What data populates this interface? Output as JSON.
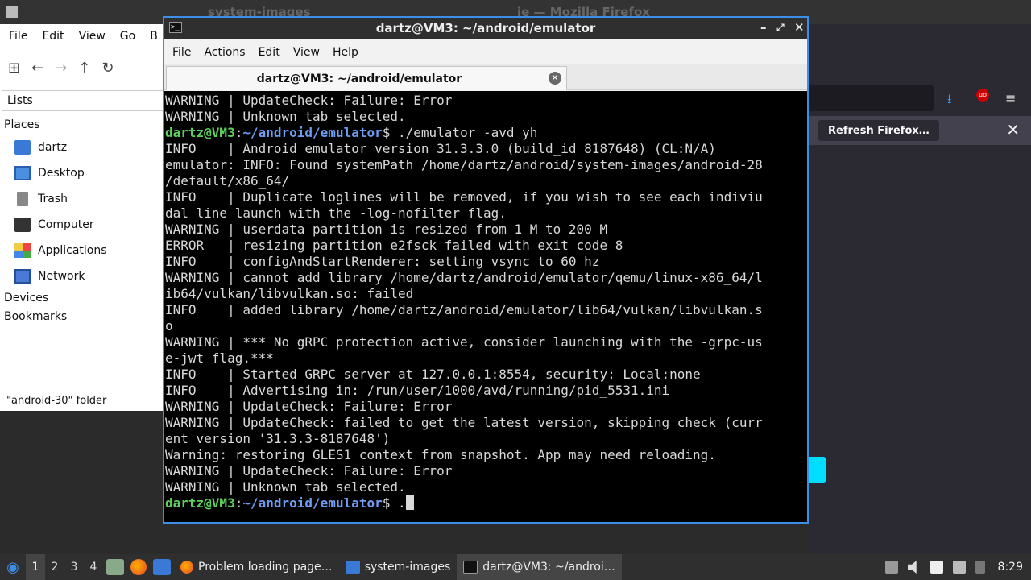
{
  "firefox": {
    "title_left": "system-images",
    "title_right": "ie — Mozilla Firefox",
    "refresh_label": "Refresh Firefox…",
    "close_glyph": "✕",
    "download_icon": "download-icon",
    "menu_icon": "hamburger-icon",
    "accent_color": "#00ddff"
  },
  "file_manager": {
    "menu": [
      "File",
      "Edit",
      "View",
      "Go",
      "B"
    ],
    "toolbar_icons": [
      "new-tab-icon",
      "back-icon",
      "forward-icon",
      "up-icon",
      "reload-icon"
    ],
    "lists_label": "Lists",
    "places_header": "Places",
    "places": [
      "dartz",
      "Desktop",
      "Trash",
      "Computer",
      "Applications",
      "Network"
    ],
    "devices_header": "Devices",
    "bookmarks_header": "Bookmarks",
    "status": "\"android-30\" folder"
  },
  "terminal": {
    "window_title": "dartz@VM3: ~/android/emulator",
    "menu": [
      "File",
      "Actions",
      "Edit",
      "View",
      "Help"
    ],
    "tab_label": "dartz@VM3: ~/android/emulator",
    "prompt_user": "dartz@VM3",
    "prompt_path": "~/android/emulator",
    "lines": [
      "WARNING | UpdateCheck: Failure: Error",
      "WARNING | Unknown tab selected.",
      "",
      "INFO    | Android emulator version 31.3.3.0 (build_id 8187648) (CL:N/A)",
      "emulator: INFO: Found systemPath /home/dartz/android/system-images/android-28",
      "/default/x86_64/",
      "INFO    | Duplicate loglines will be removed, if you wish to see each indiviu",
      "dal line launch with the -log-nofilter flag.",
      "WARNING | userdata partition is resized from 1 M to 200 M",
      "ERROR   | resizing partition e2fsck failed with exit code 8",
      "INFO    | configAndStartRenderer: setting vsync to 60 hz",
      "WARNING | cannot add library /home/dartz/android/emulator/qemu/linux-x86_64/l",
      "ib64/vulkan/libvulkan.so: failed",
      "INFO    | added library /home/dartz/android/emulator/lib64/vulkan/libvulkan.s",
      "o",
      "WARNING | *** No gRPC protection active, consider launching with the -grpc-us",
      "e-jwt flag.***",
      "INFO    | Started GRPC server at 127.0.0.1:8554, security: Local:none",
      "INFO    | Advertising in: /run/user/1000/avd/running/pid_5531.ini",
      "WARNING | UpdateCheck: Failure: Error",
      "WARNING | UpdateCheck: failed to get the latest version, skipping check (curr",
      "ent version '31.3.3-8187648')",
      "Warning: restoring GLES1 context from snapshot. App may need reloading.",
      "WARNING | UpdateCheck: Failure: Error",
      "WARNING | Unknown tab selected.",
      ""
    ],
    "command_1": " ./emulator -avd yh",
    "command_2": " .",
    "prompt_suffix": "$",
    "prompt_sep": ":"
  },
  "taskbar": {
    "workspaces": [
      "1",
      "2",
      "3",
      "4"
    ],
    "tasks": [
      {
        "label": "Problem loading page…",
        "icon": "firefox-icon"
      },
      {
        "label": "system-images",
        "icon": "folder-icon"
      },
      {
        "label": "dartz@VM3: ~/androi…",
        "icon": "terminal-icon"
      }
    ],
    "clock": "8:29"
  }
}
